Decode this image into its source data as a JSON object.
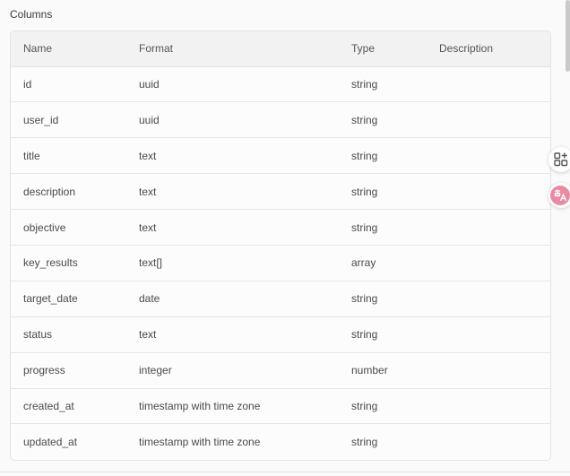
{
  "section": {
    "title": "Columns"
  },
  "table": {
    "headers": [
      "Name",
      "Format",
      "Type",
      "Description"
    ],
    "rows": [
      {
        "name": "id",
        "format": "uuid",
        "type": "string",
        "description": ""
      },
      {
        "name": "user_id",
        "format": "uuid",
        "type": "string",
        "description": ""
      },
      {
        "name": "title",
        "format": "text",
        "type": "string",
        "description": ""
      },
      {
        "name": "description",
        "format": "text",
        "type": "string",
        "description": ""
      },
      {
        "name": "objective",
        "format": "text",
        "type": "string",
        "description": ""
      },
      {
        "name": "key_results",
        "format": "text[]",
        "type": "array",
        "description": ""
      },
      {
        "name": "target_date",
        "format": "date",
        "type": "string",
        "description": ""
      },
      {
        "name": "status",
        "format": "text",
        "type": "string",
        "description": ""
      },
      {
        "name": "progress",
        "format": "integer",
        "type": "number",
        "description": ""
      },
      {
        "name": "created_at",
        "format": "timestamp with time zone",
        "type": "string",
        "description": ""
      },
      {
        "name": "updated_at",
        "format": "timestamp with time zone",
        "type": "string",
        "description": ""
      }
    ]
  },
  "floating_tools": [
    {
      "icon": "apps-add-icon"
    },
    {
      "icon": "translate-icon",
      "color": "#e98aa3"
    }
  ],
  "colors": {
    "background": "#fafafa",
    "header_bg": "#f2f2f2",
    "border": "#e3e3e3",
    "accent_pink": "#e98aa3"
  }
}
